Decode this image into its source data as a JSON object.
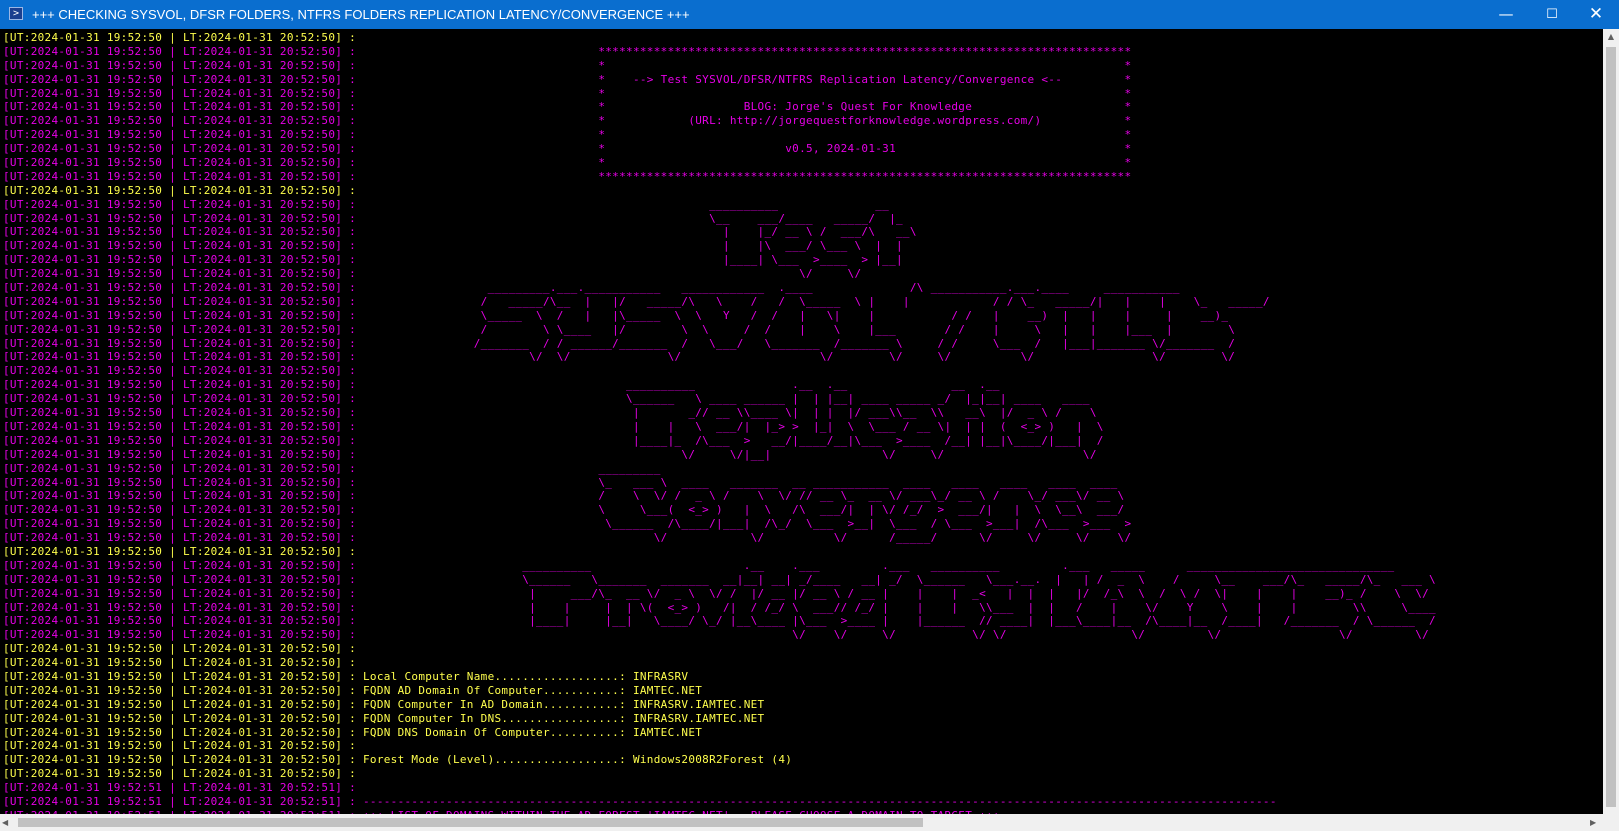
{
  "window": {
    "title": "+++ CHECKING SYSVOL, DFSR FOLDERS, NTFRS FOLDERS REPLICATION LATENCY/CONVERGENCE +++",
    "icon": "powershell-icon",
    "buttons": {
      "minimize": "—",
      "maximize": "☐",
      "close": "✕"
    }
  },
  "colors": {
    "titlebar": "#0a6ecf",
    "magenta": "#e600e6",
    "yellow": "#ffff4d",
    "background": "#000000"
  },
  "console": {
    "timestamps": {
      "a": "[UT:2024-01-31 19:52:50 | LT:2024-01-31 20:52:50] :",
      "b": "[UT:2024-01-31 19:52:51 | LT:2024-01-31 20:52:51] :"
    },
    "lines": [
      {
        "ts": "a",
        "color": "y",
        "text": ""
      },
      {
        "ts": "a",
        "color": "m",
        "text": "                                   *****************************************************************************"
      },
      {
        "ts": "a",
        "color": "m",
        "text": "                                   *                                                                           *"
      },
      {
        "ts": "a",
        "color": "m",
        "text": "                                   *    --> Test SYSVOL/DFSR/NTFRS Replication Latency/Convergence <--         *"
      },
      {
        "ts": "a",
        "color": "m",
        "text": "                                   *                                                                           *"
      },
      {
        "ts": "a",
        "color": "m",
        "text": "                                   *                    BLOG: Jorge's Quest For Knowledge                      *"
      },
      {
        "ts": "a",
        "color": "m",
        "text": "                                   *            (URL: http://jorgequestforknowledge.wordpress.com/)            *"
      },
      {
        "ts": "a",
        "color": "m",
        "text": "                                   *                                                                           *"
      },
      {
        "ts": "a",
        "color": "m",
        "text": "                                   *                          v0.5, 2024-01-31                                 *"
      },
      {
        "ts": "a",
        "color": "m",
        "text": "                                   *                                                                           *"
      },
      {
        "ts": "a",
        "color": "m",
        "text": "                                   *****************************************************************************"
      },
      {
        "ts": "a",
        "color": "y",
        "text": ""
      },
      {
        "ts": "a",
        "color": "m",
        "text": "                                                   __________              __"
      },
      {
        "ts": "a",
        "color": "m",
        "text": "                                                   \\__    ___/____   _____/  |_"
      },
      {
        "ts": "a",
        "color": "m",
        "text": "                                                     |    |_/ __ \\ /  ___/\\   __\\"
      },
      {
        "ts": "a",
        "color": "m",
        "text": "                                                     |    |\\  ___/ \\___ \\  |  |"
      },
      {
        "ts": "a",
        "color": "m",
        "text": "                                                     |____| \\___  >____  > |__|"
      },
      {
        "ts": "a",
        "color": "m",
        "text": "                                                                \\/     \\/"
      },
      {
        "ts": "a",
        "color": "m",
        "text": "                   _________.___.___________   ____________  .____              /\\ ___________.___.____     ___________"
      },
      {
        "ts": "a",
        "color": "m",
        "text": "                  /   _____/\\__  |   |/   _____/\\   \\    /   /  \\_____  \\ |    |            / / \\_   _____/|   |    |    \\_   _____/"
      },
      {
        "ts": "a",
        "color": "m",
        "text": "                  \\_____  \\  /   |   |\\_____  \\  \\   Y   /  /   |   \\|    |           / /   |    __)  |   |    |     |    __)_"
      },
      {
        "ts": "a",
        "color": "m",
        "text": "                  /        \\ \\____   |/        \\  \\     /  /    |    \\    |___       / /    |     \\   |   |    |___  |        \\"
      },
      {
        "ts": "a",
        "color": "m",
        "text": "                 /_______  / / ______/_______  /   \\___/   \\_______  /_______ \\     / /     \\___  /   |___|_______ \\/_______  /"
      },
      {
        "ts": "a",
        "color": "m",
        "text": "                         \\/  \\/              \\/                    \\/        \\/     \\/          \\/                 \\/        \\/"
      },
      {
        "ts": "a",
        "color": "m",
        "text": ""
      },
      {
        "ts": "a",
        "color": "m",
        "text": "                                       __________              .__  .__               __  .__"
      },
      {
        "ts": "a",
        "color": "m",
        "text": "                                       \\______   \\ ____ ______ |  | |__| ____ _____ _/  |_|__| ____   ____"
      },
      {
        "ts": "a",
        "color": "m",
        "text": "                                        |       _// __ \\\\____ \\|  | |  |/ ___\\\\__  \\\\   __\\  |/  _ \\ /    \\"
      },
      {
        "ts": "a",
        "color": "m",
        "text": "                                        |    |   \\  ___/|  |_> >  |_|  \\  \\___ / __ \\|  | |  (  <_> )   |  \\"
      },
      {
        "ts": "a",
        "color": "m",
        "text": "                                        |____|_  /\\___  >   __/|____/__|\\___  >____  /__| |__|\\____/|___|  /"
      },
      {
        "ts": "a",
        "color": "m",
        "text": "                                               \\/     \\/|__|                \\/     \\/                    \\/"
      },
      {
        "ts": "a",
        "color": "m",
        "text": "                                   _________"
      },
      {
        "ts": "a",
        "color": "m",
        "text": "                                   \\_   ___ \\  ____   _______  __ ___________  ____   ____   ____   ____  ____"
      },
      {
        "ts": "a",
        "color": "m",
        "text": "                                   /    \\  \\/ /  _ \\ /    \\  \\/ // __ \\_  __ \\/ ___\\_/ __ \\ /    \\_/ ___\\/ __ \\"
      },
      {
        "ts": "a",
        "color": "m",
        "text": "                                   \\     \\___(  <_> )   |  \\   /\\  ___/|  | \\/ /_/  >  ___/|   |  \\  \\__\\  ___/"
      },
      {
        "ts": "a",
        "color": "m",
        "text": "                                    \\______  /\\____/|___|  /\\_/  \\___  >__|  \\___  / \\___  >___|  /\\___  >___  >"
      },
      {
        "ts": "a",
        "color": "m",
        "text": "                                           \\/            \\/          \\/      /_____/      \\/     \\/     \\/    \\/"
      },
      {
        "ts": "a",
        "color": "y",
        "text": ""
      },
      {
        "ts": "a",
        "color": "m",
        "text": "                        __________                      .__    .___         .___   __________         .___   _____      ______________________________"
      },
      {
        "ts": "a",
        "color": "m",
        "text": "                        \\______   \\_______  _______  __|__| __| _/____   __| _/  \\______   \\___.__.  |   | /  _  \\    /     \\__    ___/\\_   _____/\\_   ___ \\"
      },
      {
        "ts": "a",
        "color": "m",
        "text": "                         |     ___/\\_  __ \\/  _ \\  \\/ /  |/ __ |/ __ \\ / __ |    |    |  _<   |  |  |   |/  /_\\  \\  /  \\ /  \\|    |    |    __)_ /    \\  \\/"
      },
      {
        "ts": "a",
        "color": "m",
        "text": "                         |    |     |  | \\(  <_> )   /|  / /_/ \\  ___// /_/ |    |    |   \\\\___  |  |   /    |    \\/    Y    \\    |    |        \\\\     \\____"
      },
      {
        "ts": "a",
        "color": "m",
        "text": "                         |____|     |__|   \\____/ \\_/ |__\\____ |\\___  >____ |    |______  // ____|  |___\\____|__  /\\____|__  /____|   /_______  / \\______  /"
      },
      {
        "ts": "a",
        "color": "m",
        "text": "                                                               \\/    \\/     \\/           \\/ \\/                  \\/         \\/                 \\/         \\/"
      },
      {
        "ts": "a",
        "color": "y",
        "text": ""
      },
      {
        "ts": "a",
        "color": "y",
        "text": ""
      },
      {
        "ts": "a",
        "color": "y",
        "text": " Local Computer Name..................: INFRASRV"
      },
      {
        "ts": "a",
        "color": "y",
        "text": " FQDN AD Domain Of Computer...........: IAMTEC.NET"
      },
      {
        "ts": "a",
        "color": "y",
        "text": " FQDN Computer In AD Domain...........: INFRASRV.IAMTEC.NET"
      },
      {
        "ts": "a",
        "color": "y",
        "text": " FQDN Computer In DNS.................: INFRASRV.IAMTEC.NET"
      },
      {
        "ts": "a",
        "color": "y",
        "text": " FQDN DNS Domain Of Computer..........: IAMTEC.NET"
      },
      {
        "ts": "a",
        "color": "y",
        "text": ""
      },
      {
        "ts": "a",
        "color": "y",
        "text": " Forest Mode (Level)..................: Windows2008R2Forest (4)"
      },
      {
        "ts": "a",
        "color": "y",
        "text": ""
      },
      {
        "ts": "b",
        "color": "m",
        "text": ""
      },
      {
        "ts": "b",
        "color": "m",
        "text": " ------------------------------------------------------------------------------------------------------------------------------------"
      },
      {
        "ts": "b",
        "color": "m",
        "text": " +++ LIST OF DOMAINS WITHIN THE AD FOREST 'IAMTEC.NET' - PLEASE CHOOSE A DOMAIN TO TARGET +++"
      }
    ]
  },
  "scrollbars": {
    "up_arrow": "▲",
    "left_arrow": "◀",
    "right_arrow": "▶"
  }
}
